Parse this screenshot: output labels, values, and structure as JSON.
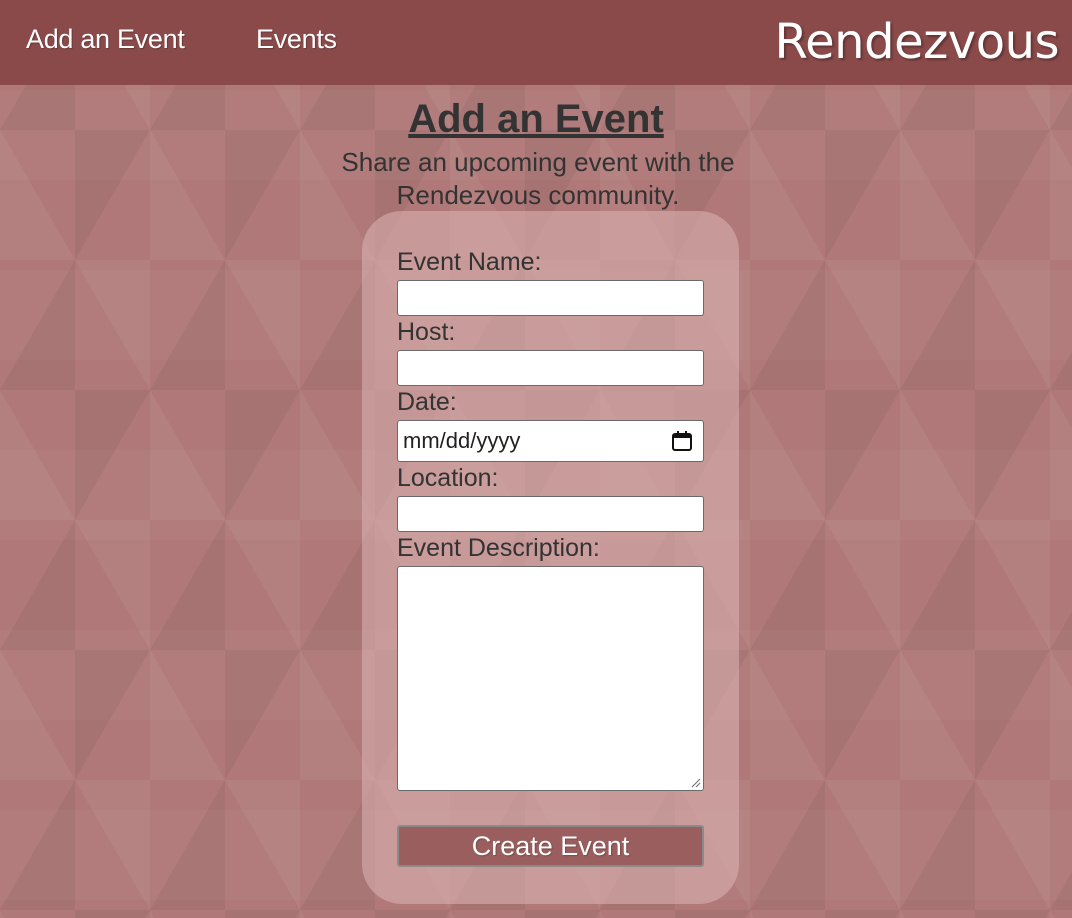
{
  "nav": {
    "add_event": "Add an Event",
    "events": "Events",
    "brand": "Rendezvous"
  },
  "header": {
    "title": "Add an Event",
    "subtitle": "Share an upcoming event with the Rendezvous community."
  },
  "form": {
    "event_name_label": "Event Name:",
    "event_name_value": "",
    "host_label": "Host:",
    "host_value": "",
    "date_label": "Date:",
    "date_placeholder": "mm/dd/yyyy",
    "location_label": "Location:",
    "location_value": "",
    "description_label": "Event Description:",
    "description_value": "",
    "submit_label": "Create Event"
  },
  "icons": {
    "calendar": "calendar-icon",
    "resize": "resize-grip-icon"
  },
  "colors": {
    "navbar": "#8a4a4a",
    "background": "#b07878",
    "button": "#9a5e5e",
    "text": "#333333"
  }
}
